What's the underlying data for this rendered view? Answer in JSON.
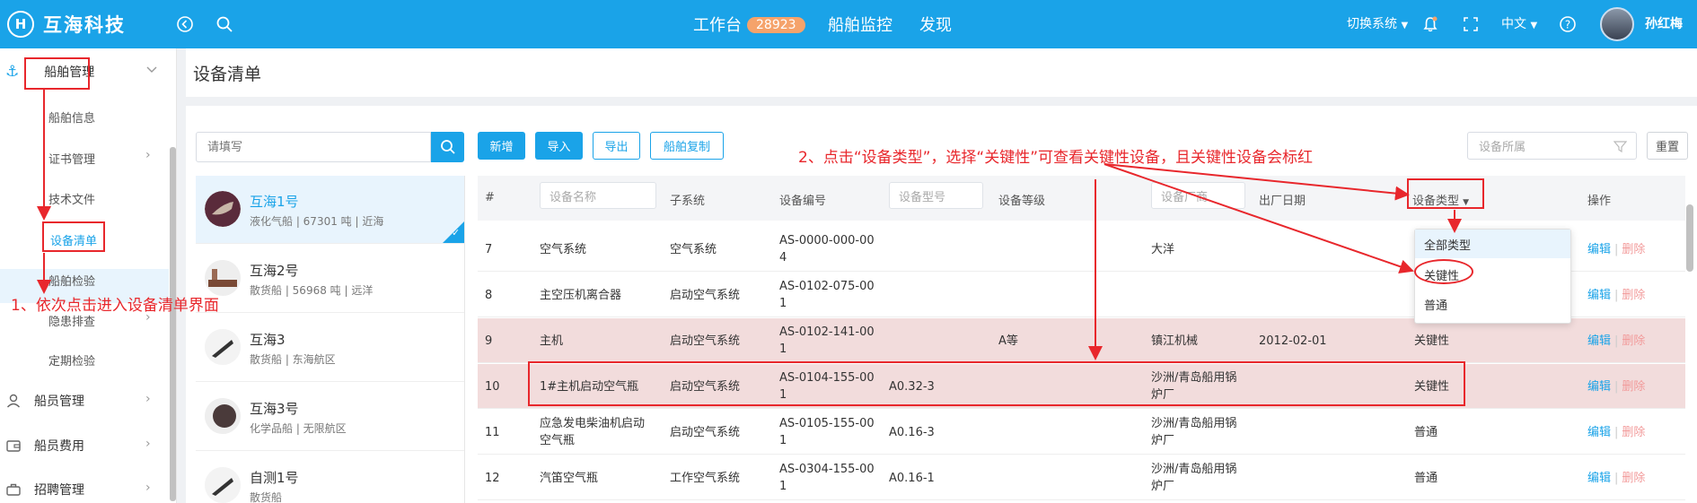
{
  "brand": {
    "logo_mark": "H",
    "name": "互海科技"
  },
  "topnav": {
    "workbench": "工作台",
    "workbench_badge": "28923",
    "ship_monitor": "船舶监控",
    "discover": "发现"
  },
  "topright": {
    "switch_system": "切换系统",
    "language": "中文",
    "username": "孙红梅"
  },
  "sidebar": {
    "ship_mgmt": "船舶管理",
    "sub": [
      "船舶信息",
      "证书管理",
      "技术文件",
      "设备清单",
      "船舶检验",
      "隐患排查",
      "定期检验"
    ],
    "crew_mgmt": "船员管理",
    "crew_cost": "船员费用",
    "recruit": "招聘管理"
  },
  "page": {
    "title": "设备清单"
  },
  "search": {
    "placeholder": "请填写"
  },
  "ships": [
    {
      "name": "互海1号",
      "sub": "液化气船 | 67301 吨 | 近海"
    },
    {
      "name": "互海2号",
      "sub": "散货船 | 56968 吨 | 远洋"
    },
    {
      "name": "互海3",
      "sub": "散货船 | 东海航区"
    },
    {
      "name": "互海3号",
      "sub": "化学品船 | 无限航区"
    },
    {
      "name": "自测1号",
      "sub": "散货船"
    }
  ],
  "toolbar": {
    "add": "新增",
    "import": "导入",
    "export": "导出",
    "copy": "船舶复制"
  },
  "filter": {
    "placeholder": "设备所属",
    "reset": "重置"
  },
  "table": {
    "headers": {
      "num": "#",
      "name_ph": "设备名称",
      "subsystem": "子系统",
      "code": "设备编号",
      "model_ph": "设备型号",
      "grade": "设备等级",
      "maker_ph": "设备厂商",
      "date": "出厂日期",
      "type": "设备类型",
      "ops": "操作"
    },
    "rows": [
      {
        "num": "7",
        "name": "空气系统",
        "subsystem": "空气系统",
        "code": "AS-0000-000-00\n4",
        "model": "",
        "grade": "",
        "maker": "大洋",
        "date": "",
        "type": "",
        "critical": false
      },
      {
        "num": "8",
        "name": "主空压机离合器",
        "subsystem": "启动空气系统",
        "code": "AS-0102-075-00\n1",
        "model": "",
        "grade": "",
        "maker": "",
        "date": "",
        "type": "",
        "critical": false
      },
      {
        "num": "9",
        "name": "主机",
        "subsystem": "启动空气系统",
        "code": "AS-0102-141-00\n1",
        "model": "",
        "grade": "A等",
        "maker": "镇江机械",
        "date": "2012-02-01",
        "type": "关键性",
        "critical": true
      },
      {
        "num": "10",
        "name": "1#主机启动空气瓶",
        "subsystem": "启动空气系统",
        "code": "AS-0104-155-00\n1",
        "model": "A0.32-3",
        "grade": "",
        "maker": "沙洲/青岛船用锅\n炉厂",
        "date": "",
        "type": "关键性",
        "critical": true
      },
      {
        "num": "11",
        "name": "应急发电柴油机启动\n空气瓶",
        "subsystem": "启动空气系统",
        "code": "AS-0105-155-00\n1",
        "model": "A0.16-3",
        "grade": "",
        "maker": "沙洲/青岛船用锅\n炉厂",
        "date": "",
        "type": "普通",
        "critical": false
      },
      {
        "num": "12",
        "name": "汽笛空气瓶",
        "subsystem": "工作空气系统",
        "code": "AS-0304-155-00\n1",
        "model": "A0.16-1",
        "grade": "",
        "maker": "沙洲/青岛船用锅\n炉厂",
        "date": "",
        "type": "普通",
        "critical": false
      }
    ],
    "edit": "编辑",
    "delete": "删除"
  },
  "type_dropdown": [
    "全部类型",
    "关键性",
    "普通"
  ],
  "annotations": {
    "step1": "1、依次点击进入设备清单界面",
    "step2": "2、点击“设备类型”，选择“关键性”可查看关键性设备，且关键性设备会标红"
  },
  "colors": {
    "primary": "#1aa3e8",
    "critical_row": "#f2dcdc",
    "annotation": "#e8272c"
  }
}
